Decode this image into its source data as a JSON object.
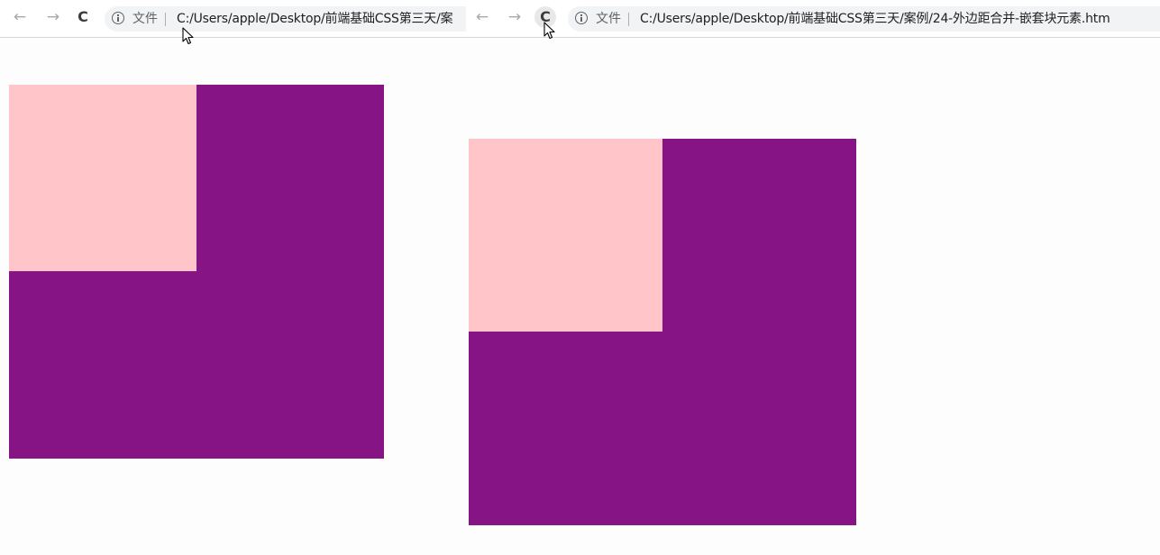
{
  "left_window": {
    "nav": {
      "back_icon": "←",
      "forward_icon": "→",
      "reload_icon": "C"
    },
    "address_bar": {
      "scheme_label": "文件",
      "url": "C:/Users/apple/Desktop/前端基础CSS第三天/案"
    },
    "colors": {
      "outer_box": "#871485",
      "inner_box": "#ffc5c8"
    }
  },
  "right_window": {
    "nav": {
      "back_icon": "←",
      "forward_icon": "→",
      "reload_icon": "C"
    },
    "address_bar": {
      "scheme_label": "文件",
      "url": "C:/Users/apple/Desktop/前端基础CSS第三天/案例/24-外边距合并-嵌套块元素.htm"
    },
    "colors": {
      "outer_box": "#871485",
      "inner_box": "#ffc5c8"
    }
  }
}
